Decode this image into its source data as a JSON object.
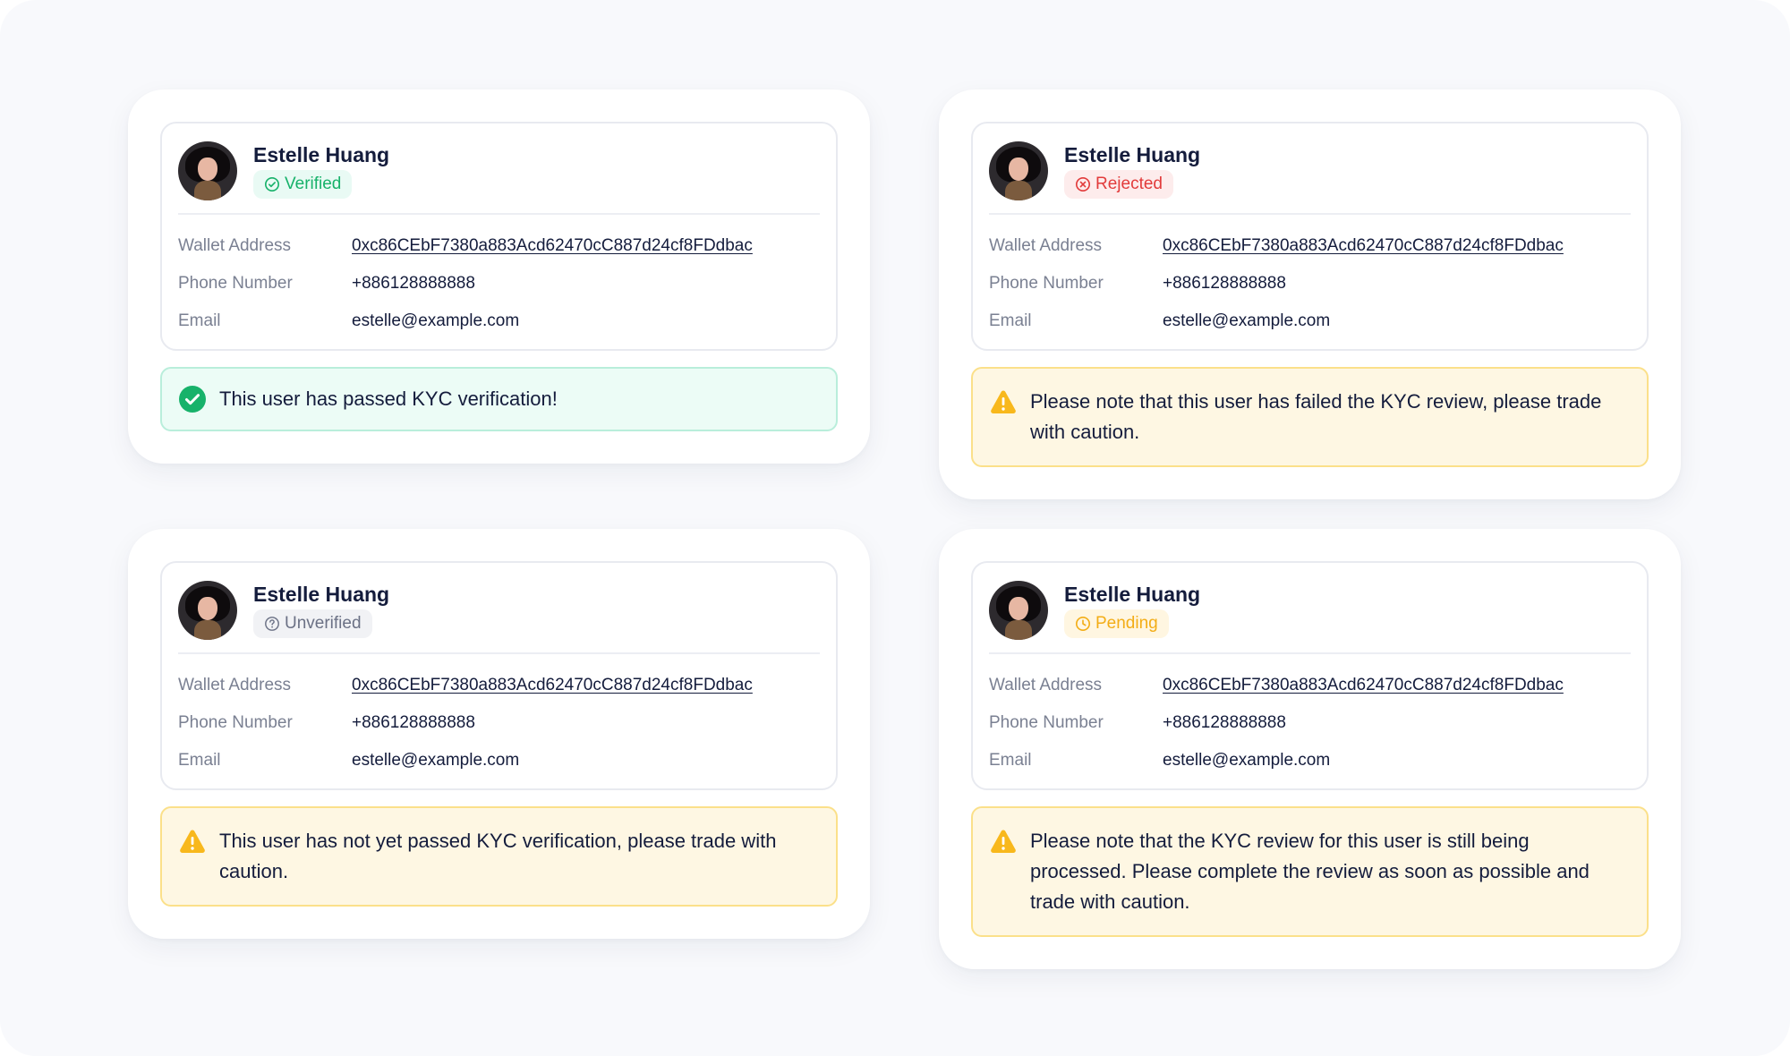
{
  "cards": [
    {
      "name": "Estelle Huang",
      "status": "Verified",
      "wallet_label": "Wallet Address",
      "wallet": "0xc86CEbF7380a883Acd62470cC887d24cf8FDdbac",
      "phone_label": "Phone Number",
      "phone": "+886128888888",
      "email_label": "Email",
      "email": "estelle@example.com",
      "message": "This user has passed KYC verification!"
    },
    {
      "name": "Estelle Huang",
      "status": "Rejected",
      "wallet_label": "Wallet Address",
      "wallet": "0xc86CEbF7380a883Acd62470cC887d24cf8FDdbac",
      "phone_label": "Phone Number",
      "phone": "+886128888888",
      "email_label": "Email",
      "email": "estelle@example.com",
      "message": "Please note that this user has failed the KYC review, please trade with caution."
    },
    {
      "name": "Estelle Huang",
      "status": "Unverified",
      "wallet_label": "Wallet Address",
      "wallet": "0xc86CEbF7380a883Acd62470cC887d24cf8FDdbac",
      "phone_label": "Phone Number",
      "phone": "+886128888888",
      "email_label": "Email",
      "email": "estelle@example.com",
      "message": "This user has not yet passed KYC verification, please trade with caution."
    },
    {
      "name": "Estelle Huang",
      "status": "Pending",
      "wallet_label": "Wallet Address",
      "wallet": "0xc86CEbF7380a883Acd62470cC887d24cf8FDdbac",
      "phone_label": "Phone Number",
      "phone": "+886128888888",
      "email_label": "Email",
      "email": "estelle@example.com",
      "message": "Please note that the KYC review for this user is still being processed. Please complete the review as soon as possible and trade with caution."
    }
  ],
  "colors": {
    "verified": "#17b26a",
    "rejected": "#e23b3b",
    "unverified": "#6b7185",
    "pending": "#f3ad16",
    "warning_icon": "#f8b81c"
  },
  "icons": {
    "verified": "check-circle-icon",
    "rejected": "x-circle-icon",
    "unverified": "question-circle-icon",
    "pending": "clock-icon",
    "success_alert": "check-filled-icon",
    "warning_alert": "warning-triangle-icon"
  }
}
